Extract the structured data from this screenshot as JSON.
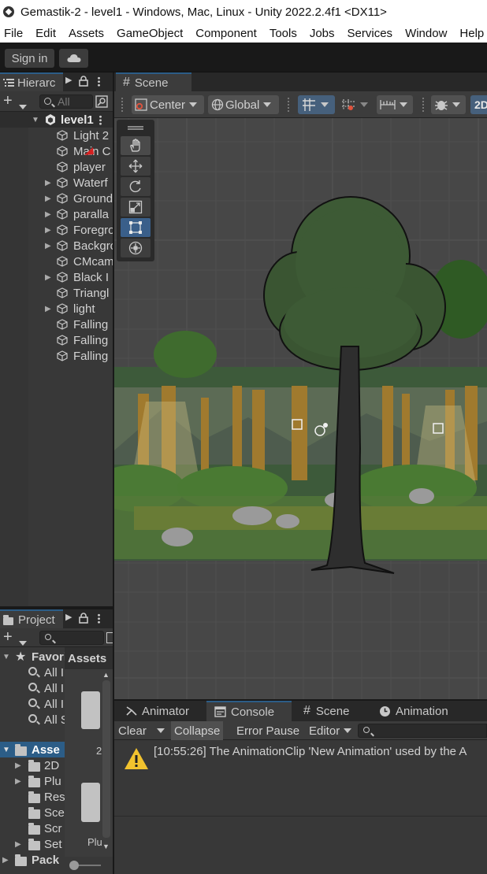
{
  "window": {
    "title": "Gemastik-2 - level1 - Windows, Mac, Linux - Unity 2022.2.4f1 <DX11>"
  },
  "menu": [
    "File",
    "Edit",
    "Assets",
    "GameObject",
    "Component",
    "Tools",
    "Jobs",
    "Services",
    "Window",
    "Help"
  ],
  "toolbar": {
    "sign_in": "Sign in",
    "cloud_icon": "cloud-icon"
  },
  "hierarchy": {
    "tab_label": "Hierarc",
    "search_placeholder": "All",
    "scene_name": "level1",
    "items": [
      {
        "label": "Light 2",
        "expandable": false
      },
      {
        "label": "Main C",
        "expandable": false
      },
      {
        "label": "player",
        "expandable": false
      },
      {
        "label": "Waterf",
        "expandable": true
      },
      {
        "label": "Ground",
        "expandable": true
      },
      {
        "label": "paralla",
        "expandable": true
      },
      {
        "label": "Foregro",
        "expandable": true
      },
      {
        "label": "Backgro",
        "expandable": true
      },
      {
        "label": "CMcam",
        "expandable": false
      },
      {
        "label": "Black I",
        "expandable": true
      },
      {
        "label": "Triangl",
        "expandable": false
      },
      {
        "label": "light",
        "expandable": true
      },
      {
        "label": "Falling",
        "expandable": false
      },
      {
        "label": "Falling",
        "expandable": false
      },
      {
        "label": "Falling",
        "expandable": false
      }
    ]
  },
  "scene": {
    "tab_label": "Scene",
    "pivot": "Center",
    "space": "Global",
    "mode_2d": "2D",
    "tools": [
      "hand-tool",
      "move-tool",
      "rotate-tool",
      "scale-tool",
      "rect-tool",
      "transform-tool"
    ],
    "active_tool": "rect-tool"
  },
  "bottom_tabs": [
    {
      "label": "Animator",
      "icon": "animator-icon",
      "active": false
    },
    {
      "label": "Console",
      "icon": "console-icon",
      "active": true
    },
    {
      "label": "Scene",
      "icon": "scene-grid-icon",
      "active": false
    },
    {
      "label": "Animation",
      "icon": "animation-clock-icon",
      "active": false
    }
  ],
  "console": {
    "clear": "Clear",
    "collapse": "Collapse",
    "error_pause": "Error Pause",
    "editor": "Editor",
    "log_message": "[10:55:26] The AnimationClip 'New Animation' used by the A"
  },
  "project": {
    "tab_label": "Project",
    "favorites_label": "Favori",
    "favorites_items": [
      "All I",
      "All I",
      "All I",
      "All S"
    ],
    "assets_label": "Asse",
    "folders": [
      {
        "label": "2D",
        "expandable": true
      },
      {
        "label": "Plu",
        "expandable": true
      },
      {
        "label": "Res",
        "expandable": false
      },
      {
        "label": "Sce",
        "expandable": false
      },
      {
        "label": "Scr",
        "expandable": false
      },
      {
        "label": "Set",
        "expandable": true
      }
    ],
    "packages_label": "Pack",
    "assets_header": "Assets",
    "assets_count": "2",
    "asset_caption": "Plu"
  },
  "colors": {
    "accent_blue": "#3a5f8a",
    "panel": "#383838",
    "warning": "#f2c32e"
  }
}
